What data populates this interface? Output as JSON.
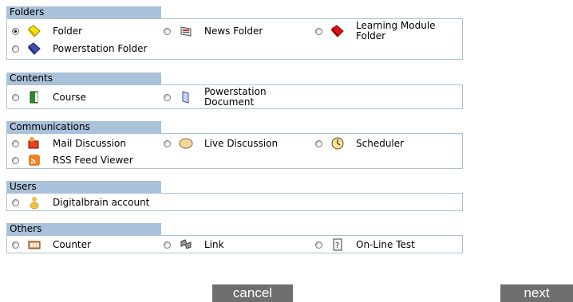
{
  "sections": [
    {
      "title": "Folders",
      "options": [
        {
          "label": "Folder",
          "icon": "yellow-folder-icon",
          "selected": true
        },
        {
          "label": "News Folder",
          "icon": "news-folder-icon",
          "selected": false
        },
        {
          "label": "Learning Module Folder",
          "icon": "red-folder-icon",
          "selected": false
        },
        {
          "label": "Powerstation Folder",
          "icon": "blue-folder-icon",
          "selected": false
        }
      ]
    },
    {
      "title": "Contents",
      "options": [
        {
          "label": "Course",
          "icon": "green-book-icon",
          "selected": false
        },
        {
          "label": "Powerstation Document",
          "icon": "blue-document-icon",
          "selected": false
        }
      ]
    },
    {
      "title": "Communications",
      "options": [
        {
          "label": "Mail Discussion",
          "icon": "mail-icon",
          "selected": false
        },
        {
          "label": "Live Discussion",
          "icon": "chat-bubble-icon",
          "selected": false
        },
        {
          "label": "Scheduler",
          "icon": "clock-icon",
          "selected": false
        },
        {
          "label": "RSS Feed Viewer",
          "icon": "rss-icon",
          "selected": false
        }
      ]
    },
    {
      "title": "Users",
      "options": [
        {
          "label": "Digitalbrain account",
          "icon": "user-icon",
          "selected": false
        }
      ]
    },
    {
      "title": "Others",
      "options": [
        {
          "label": "Counter",
          "icon": "counter-icon",
          "selected": false
        },
        {
          "label": "Link",
          "icon": "link-icon",
          "selected": false
        },
        {
          "label": "On-Line Test",
          "icon": "test-icon",
          "selected": false
        }
      ]
    }
  ],
  "buttons": {
    "cancel": "cancel",
    "next": "next"
  },
  "colors": {
    "section_header": "#a9c1d9",
    "button_bg": "#6e6e6e"
  }
}
